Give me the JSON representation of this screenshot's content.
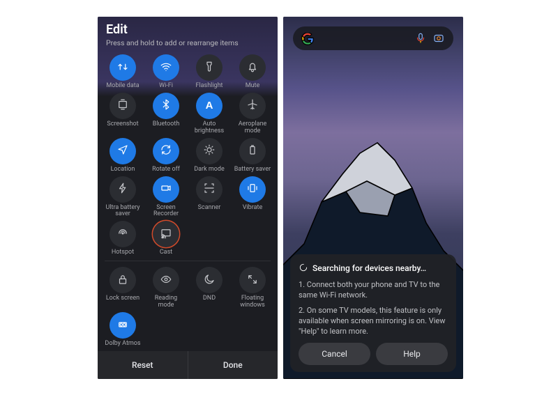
{
  "left": {
    "title": "Edit",
    "subtitle": "Press and hold to add or rearrange items",
    "tiles": [
      {
        "id": "mobile-data",
        "label": "Mobile data",
        "on": true
      },
      {
        "id": "wifi",
        "label": "Wi-Fi",
        "on": true
      },
      {
        "id": "flashlight",
        "label": "Flashlight",
        "on": false
      },
      {
        "id": "mute",
        "label": "Mute",
        "on": false
      },
      {
        "id": "screenshot",
        "label": "Screenshot",
        "on": false
      },
      {
        "id": "bluetooth",
        "label": "Bluetooth",
        "on": true
      },
      {
        "id": "auto-brightness",
        "label": "Auto brightness",
        "on": true
      },
      {
        "id": "aeroplane",
        "label": "Aeroplane mode",
        "on": false
      },
      {
        "id": "location",
        "label": "Location",
        "on": true
      },
      {
        "id": "rotate",
        "label": "Rotate off",
        "on": true
      },
      {
        "id": "dark-mode",
        "label": "Dark mode",
        "on": false
      },
      {
        "id": "battery-saver",
        "label": "Battery saver",
        "on": false
      },
      {
        "id": "ultra-battery",
        "label": "Ultra battery saver",
        "on": false
      },
      {
        "id": "screen-recorder",
        "label": "Screen Recorder",
        "on": true
      },
      {
        "id": "scanner",
        "label": "Scanner",
        "on": false
      },
      {
        "id": "vibrate",
        "label": "Vibrate",
        "on": true
      },
      {
        "id": "hotspot",
        "label": "Hotspot",
        "on": false
      },
      {
        "id": "cast",
        "label": "Cast",
        "on": false,
        "highlight": true
      }
    ],
    "tiles2": [
      {
        "id": "lock-screen",
        "label": "Lock screen"
      },
      {
        "id": "reading-mode",
        "label": "Reading mode"
      },
      {
        "id": "dnd",
        "label": "DND"
      },
      {
        "id": "floating-windows",
        "label": "Floating windows"
      },
      {
        "id": "dolby",
        "label": "Dolby Atmos",
        "on": true
      }
    ],
    "reset": "Reset",
    "done": "Done"
  },
  "right": {
    "dialog": {
      "title": "Searching for devices nearby…",
      "line1": "1. Connect both your phone and TV to the same Wi-Fi network.",
      "line2": "2. On some TV models, this feature is only available when screen mirroring is on. View \"Help\" to learn more.",
      "cancel": "Cancel",
      "help": "Help"
    }
  }
}
